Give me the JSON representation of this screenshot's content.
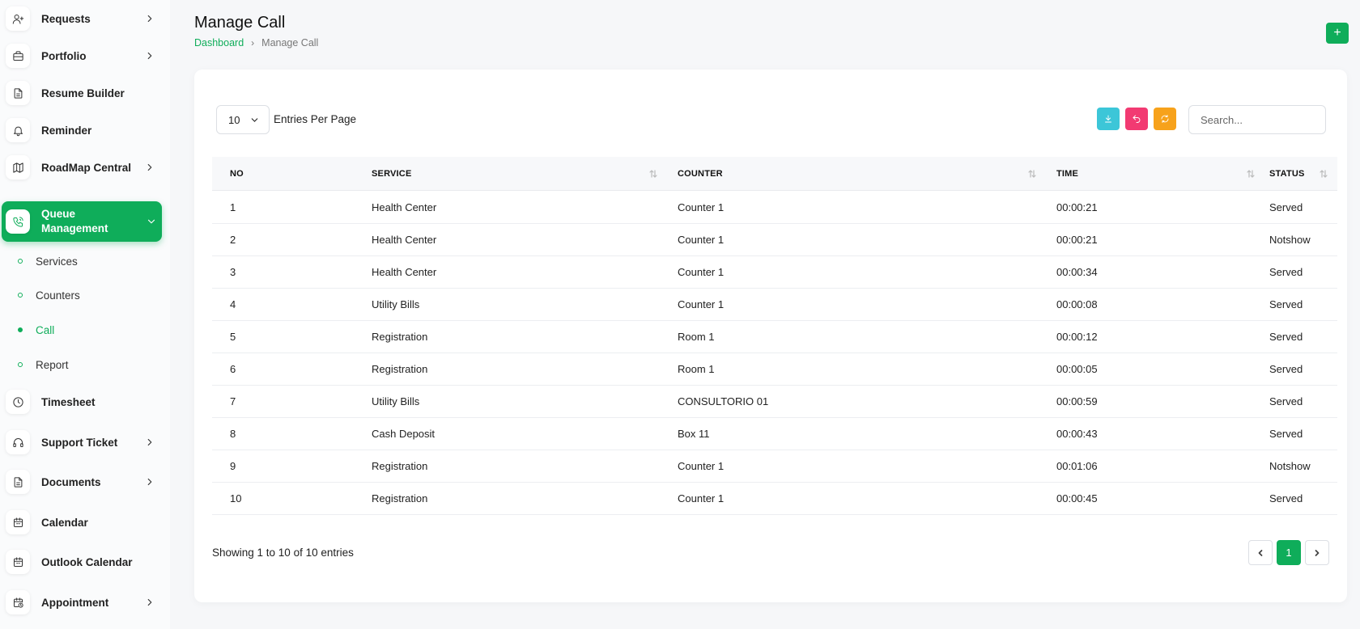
{
  "sidebar": {
    "items": [
      {
        "label": "Requests",
        "icon": "user-plus-icon",
        "chevron": true
      },
      {
        "label": "Portfolio",
        "icon": "briefcase-icon",
        "chevron": true
      },
      {
        "label": "Resume Builder",
        "icon": "file-icon",
        "chevron": false
      },
      {
        "label": "Reminder",
        "icon": "bell-icon",
        "chevron": false
      },
      {
        "label": "RoadMap Central",
        "icon": "map-icon",
        "chevron": true
      },
      {
        "label": "Queue Management",
        "icon": "phone-call-icon",
        "chevron": true,
        "active": true
      },
      {
        "label": "Timesheet",
        "icon": "clock-icon",
        "chevron": false
      },
      {
        "label": "Support Ticket",
        "icon": "headphones-icon",
        "chevron": true
      },
      {
        "label": "Documents",
        "icon": "file-icon",
        "chevron": true
      },
      {
        "label": "Calendar",
        "icon": "calendar-icon",
        "chevron": false
      },
      {
        "label": "Outlook Calendar",
        "icon": "calendar-icon",
        "chevron": false
      },
      {
        "label": "Appointment",
        "icon": "calendar-clock-icon",
        "chevron": true
      }
    ],
    "subitems": [
      {
        "label": "Services"
      },
      {
        "label": "Counters"
      },
      {
        "label": "Call",
        "current": true
      },
      {
        "label": "Report"
      }
    ]
  },
  "header": {
    "title": "Manage Call",
    "breadcrumb": {
      "home": "Dashboard",
      "current": "Manage Call"
    },
    "add_label": "+"
  },
  "controls": {
    "entries_value": "10",
    "entries_label": "Entries Per Page",
    "search_placeholder": "Search...",
    "colors": {
      "export": "#3cc6d8",
      "back": "#f23a72",
      "refresh": "#f7a21b",
      "accent": "#0fad5a"
    }
  },
  "table": {
    "columns": [
      "NO",
      "SERVICE",
      "COUNTER",
      "TIME",
      "STATUS"
    ],
    "rows": [
      [
        "1",
        "Health Center",
        "Counter 1",
        "00:00:21",
        "Served"
      ],
      [
        "2",
        "Health Center",
        "Counter 1",
        "00:00:21",
        "Notshow"
      ],
      [
        "3",
        "Health Center",
        "Counter 1",
        "00:00:34",
        "Served"
      ],
      [
        "4",
        "Utility Bills",
        "Counter 1",
        "00:00:08",
        "Served"
      ],
      [
        "5",
        "Registration",
        "Room 1",
        "00:00:12",
        "Served"
      ],
      [
        "6",
        "Registration",
        "Room 1",
        "00:00:05",
        "Served"
      ],
      [
        "7",
        "Utility Bills",
        "CONSULTORIO 01",
        "00:00:59",
        "Served"
      ],
      [
        "8",
        "Cash Deposit",
        "Box 11",
        "00:00:43",
        "Served"
      ],
      [
        "9",
        "Registration",
        "Counter 1",
        "00:01:06",
        "Notshow"
      ],
      [
        "10",
        "Registration",
        "Counter 1",
        "00:00:45",
        "Served"
      ]
    ]
  },
  "footer": {
    "info": "Showing 1 to 10 of 10 entries",
    "current_page": "1"
  }
}
